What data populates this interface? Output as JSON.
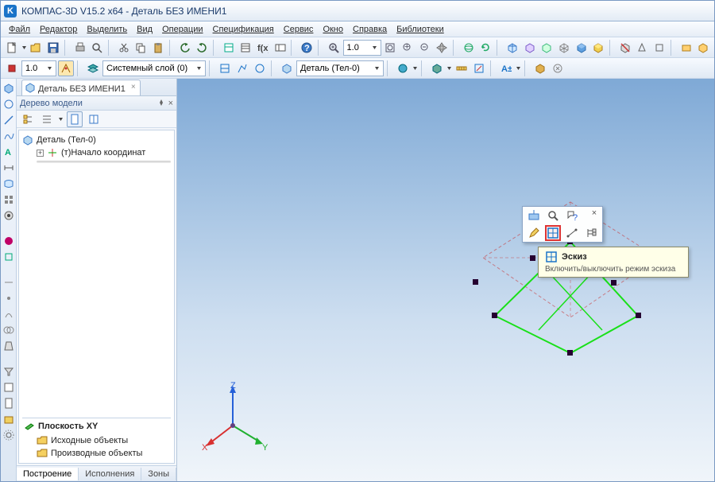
{
  "app": {
    "icon_letter": "K",
    "title": "КОМПАС-3D V15.2  x64 - Деталь БЕЗ ИМЕНИ1"
  },
  "menus": [
    "Файл",
    "Редактор",
    "Выделить",
    "Вид",
    "Операции",
    "Спецификация",
    "Сервис",
    "Окно",
    "Справка",
    "Библиотеки"
  ],
  "toolbar1_dd1": "",
  "zoom_value": "1.0",
  "layer_dd": "Системный слой (0)",
  "part_dd": "Деталь (Тел-0)",
  "doc_tab": "Деталь БЕЗ ИМЕНИ1",
  "tree": {
    "title": "Дерево модели",
    "root": "Деталь (Тел-0)",
    "child1": "(т)Начало координат",
    "plane": "Плоскость XY",
    "src": "Исходные объекты",
    "deriv": "Производные объекты"
  },
  "bottom_tabs": [
    "Построение",
    "Исполнения",
    "Зоны"
  ],
  "axes": {
    "x": "X",
    "y": "Y",
    "z": "Z"
  },
  "tooltip": {
    "title": "Эскиз",
    "sub": "Включить/выключить режим эскиза"
  },
  "colors": {
    "accent": "#1a73c8",
    "highlight": "#d33"
  }
}
